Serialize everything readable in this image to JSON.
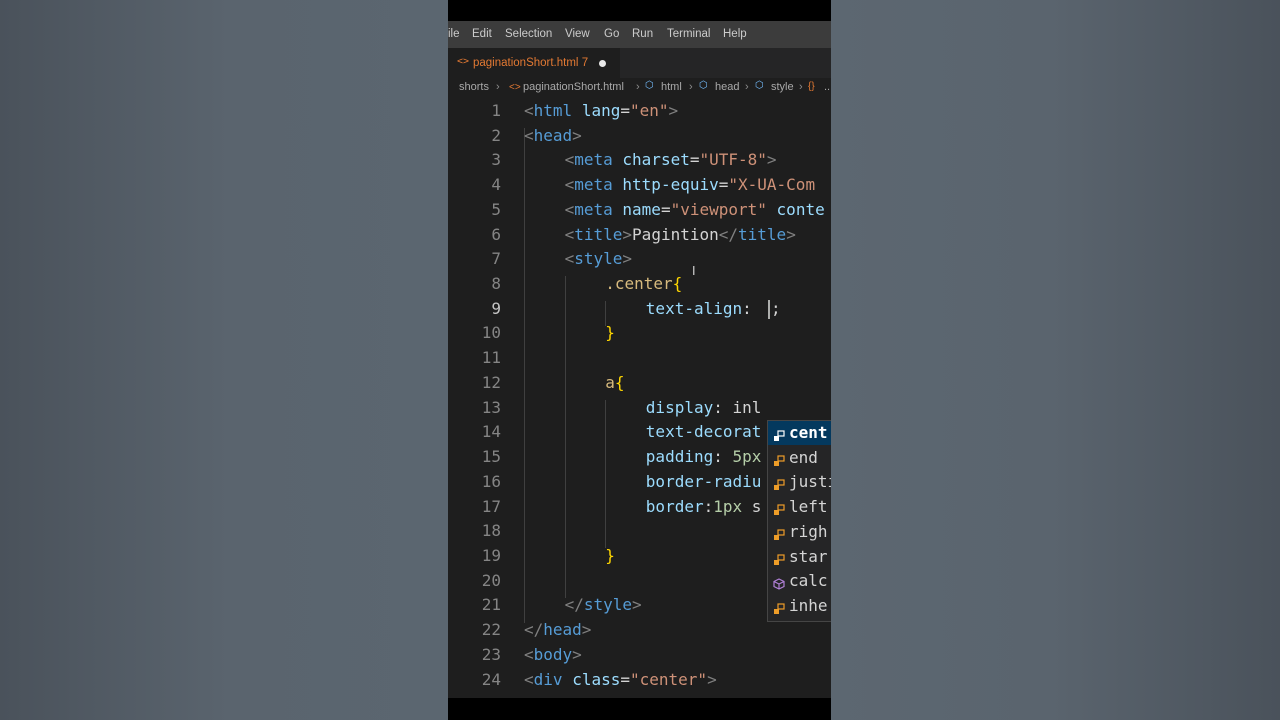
{
  "menubar": [
    "ile",
    "Edit",
    "Selection",
    "View",
    "Go",
    "Run",
    "Terminal",
    "Help"
  ],
  "tab": {
    "filename": "paginationShort.html",
    "problems": "7",
    "modified": true
  },
  "breadcrumb": [
    "shorts",
    "paginationShort.html",
    "html",
    "head",
    "style",
    "..."
  ],
  "editor": {
    "active_line": 9,
    "lines": [
      {
        "n": "1",
        "indent": 0,
        "tokens": [
          [
            "p",
            "<"
          ],
          [
            "tag",
            "html"
          ],
          [
            "txt",
            " "
          ],
          [
            "attr",
            "lang"
          ],
          [
            "txt",
            "="
          ],
          [
            "str",
            "\"en\""
          ],
          [
            "p",
            ">"
          ]
        ]
      },
      {
        "n": "2",
        "indent": 0,
        "tokens": [
          [
            "p",
            "<"
          ],
          [
            "tag",
            "head"
          ],
          [
            "p",
            ">"
          ]
        ]
      },
      {
        "n": "3",
        "indent": 1,
        "tokens": [
          [
            "p",
            "<"
          ],
          [
            "tag",
            "meta"
          ],
          [
            "txt",
            " "
          ],
          [
            "attr",
            "charset"
          ],
          [
            "txt",
            "="
          ],
          [
            "str",
            "\"UTF-8\""
          ],
          [
            "p",
            ">"
          ]
        ]
      },
      {
        "n": "4",
        "indent": 1,
        "tokens": [
          [
            "p",
            "<"
          ],
          [
            "tag",
            "meta"
          ],
          [
            "txt",
            " "
          ],
          [
            "attr",
            "http-equiv"
          ],
          [
            "txt",
            "="
          ],
          [
            "str",
            "\"X-UA-Com"
          ]
        ]
      },
      {
        "n": "5",
        "indent": 1,
        "tokens": [
          [
            "p",
            "<"
          ],
          [
            "tag",
            "meta"
          ],
          [
            "txt",
            " "
          ],
          [
            "attr",
            "name"
          ],
          [
            "txt",
            "="
          ],
          [
            "str",
            "\"viewport\""
          ],
          [
            "txt",
            " "
          ],
          [
            "attr",
            "conte"
          ]
        ]
      },
      {
        "n": "6",
        "indent": 1,
        "tokens": [
          [
            "p",
            "<"
          ],
          [
            "tag",
            "title"
          ],
          [
            "p",
            ">"
          ],
          [
            "txt",
            "Pagintion"
          ],
          [
            "p",
            "</"
          ],
          [
            "tag",
            "title"
          ],
          [
            "p",
            ">"
          ]
        ]
      },
      {
        "n": "7",
        "indent": 1,
        "tokens": [
          [
            "p",
            "<"
          ],
          [
            "tag",
            "style"
          ],
          [
            "p",
            ">"
          ]
        ]
      },
      {
        "n": "8",
        "indent": 2,
        "tokens": [
          [
            "sel",
            ".center"
          ],
          [
            "brace",
            "{"
          ]
        ]
      },
      {
        "n": "9",
        "indent": 3,
        "tokens": [
          [
            "prop",
            "text-align"
          ],
          [
            "txt",
            ": "
          ],
          [
            "txt",
            " ;"
          ]
        ]
      },
      {
        "n": "10",
        "indent": 2,
        "tokens": [
          [
            "brace",
            "}"
          ]
        ]
      },
      {
        "n": "11",
        "indent": 0,
        "tokens": []
      },
      {
        "n": "12",
        "indent": 2,
        "tokens": [
          [
            "sel",
            "a"
          ],
          [
            "brace",
            "{"
          ]
        ]
      },
      {
        "n": "13",
        "indent": 3,
        "tokens": [
          [
            "prop",
            "display"
          ],
          [
            "txt",
            ": inl"
          ]
        ]
      },
      {
        "n": "14",
        "indent": 3,
        "tokens": [
          [
            "prop",
            "text-decorat"
          ]
        ]
      },
      {
        "n": "15",
        "indent": 3,
        "tokens": [
          [
            "prop",
            "padding"
          ],
          [
            "txt",
            ": "
          ],
          [
            "num",
            "5px"
          ]
        ]
      },
      {
        "n": "16",
        "indent": 3,
        "tokens": [
          [
            "prop",
            "border-radiu"
          ]
        ]
      },
      {
        "n": "17",
        "indent": 3,
        "tokens": [
          [
            "prop",
            "border"
          ],
          [
            "txt",
            ":"
          ],
          [
            "num",
            "1px"
          ],
          [
            "txt",
            " s"
          ]
        ]
      },
      {
        "n": "18",
        "indent": 0,
        "tokens": []
      },
      {
        "n": "19",
        "indent": 2,
        "tokens": [
          [
            "brace",
            "}"
          ]
        ]
      },
      {
        "n": "20",
        "indent": 0,
        "tokens": []
      },
      {
        "n": "21",
        "indent": 1,
        "tokens": [
          [
            "p",
            "</"
          ],
          [
            "tag",
            "style"
          ],
          [
            "p",
            ">"
          ]
        ]
      },
      {
        "n": "22",
        "indent": 0,
        "tokens": [
          [
            "p",
            "</"
          ],
          [
            "tag",
            "head"
          ],
          [
            "p",
            ">"
          ]
        ]
      },
      {
        "n": "23",
        "indent": 0,
        "tokens": [
          [
            "p",
            "<"
          ],
          [
            "tag",
            "body"
          ],
          [
            "p",
            ">"
          ]
        ]
      },
      {
        "n": "24",
        "indent": 0,
        "tokens": [
          [
            "p",
            "<"
          ],
          [
            "tag",
            "div"
          ],
          [
            "txt",
            " "
          ],
          [
            "attr",
            "class"
          ],
          [
            "txt",
            "="
          ],
          [
            "str",
            "\"center\""
          ],
          [
            "p",
            ">"
          ]
        ]
      }
    ]
  },
  "suggestions": [
    {
      "label": "cent",
      "kind": "enum",
      "selected": true
    },
    {
      "label": "end",
      "kind": "enum",
      "selected": false
    },
    {
      "label": "justi",
      "kind": "enum",
      "selected": false
    },
    {
      "label": "left",
      "kind": "enum",
      "selected": false
    },
    {
      "label": "righ",
      "kind": "enum",
      "selected": false
    },
    {
      "label": "star",
      "kind": "enum",
      "selected": false
    },
    {
      "label": "calc",
      "kind": "function",
      "selected": false
    },
    {
      "label": "inhe",
      "kind": "enum",
      "selected": false
    }
  ],
  "colors": {
    "editor_bg": "#1e1e1e",
    "menubar_bg": "#3c3c3c",
    "tab_text": "#e37933",
    "suggest_selected": "#04395e",
    "enum_icon": "#ee9d28",
    "function_icon": "#b180d7"
  }
}
